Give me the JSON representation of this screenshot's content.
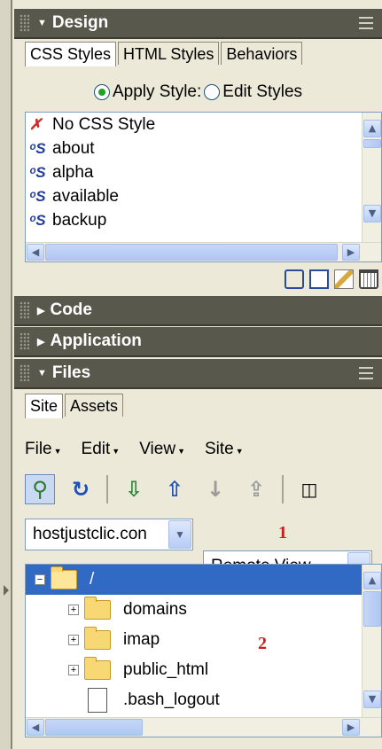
{
  "design_panel": {
    "title": "Design",
    "tabs": [
      "CSS Styles",
      "HTML Styles",
      "Behaviors"
    ],
    "apply_style_label": "Apply Style:",
    "edit_styles_label": "Edit Styles",
    "styles": [
      {
        "icon": "no-style-icon",
        "label": "No CSS Style"
      },
      {
        "icon": "css-style-icon",
        "label": "about"
      },
      {
        "icon": "css-style-icon",
        "label": "alpha"
      },
      {
        "icon": "css-style-icon",
        "label": "available"
      },
      {
        "icon": "css-style-icon",
        "label": "backup"
      }
    ]
  },
  "code_panel": {
    "title": "Code"
  },
  "application_panel": {
    "title": "Application"
  },
  "files_panel": {
    "title": "Files",
    "tabs": [
      "Site",
      "Assets"
    ],
    "menus": [
      "File",
      "Edit",
      "View",
      "Site"
    ],
    "site_select": "hostjustclic.con",
    "view_select": "Remote View",
    "marker1": "1",
    "marker2": "2",
    "tree": [
      {
        "type": "folder",
        "label": "/",
        "expanded": true,
        "selected": true
      },
      {
        "type": "folder",
        "label": "domains"
      },
      {
        "type": "folder",
        "label": "imap"
      },
      {
        "type": "folder",
        "label": "public_html"
      },
      {
        "type": "file",
        "label": ".bash_logout"
      }
    ]
  }
}
